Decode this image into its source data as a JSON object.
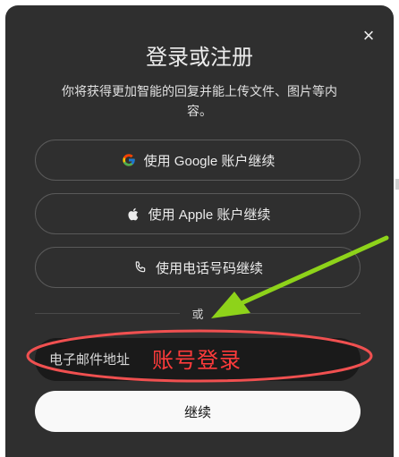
{
  "dialog": {
    "title": "登录或注册",
    "subtitle": "你将获得更加智能的回复并能上传文件、图片等内容。",
    "close_label": "×"
  },
  "buttons": {
    "google": {
      "label": "使用 Google 账户继续",
      "icon": "google-icon"
    },
    "apple": {
      "label": "使用 Apple 账户继续",
      "icon": "apple-icon"
    },
    "phone": {
      "label": "使用电话号码继续",
      "icon": "phone-icon"
    }
  },
  "divider": {
    "text": "或"
  },
  "email": {
    "placeholder": "电子邮件地址",
    "value": ""
  },
  "continue": {
    "label": "继续"
  },
  "annotation": {
    "text": "账号登录",
    "colors": {
      "ellipse": "#f05050",
      "arrow": "#8ed31a",
      "text": "#ff3b3b"
    }
  },
  "colors": {
    "modal_bg": "#2f2f2f",
    "input_bg": "#1a1a1a",
    "button_border": "#5a5a5a",
    "continue_bg": "#f9f9f9"
  }
}
